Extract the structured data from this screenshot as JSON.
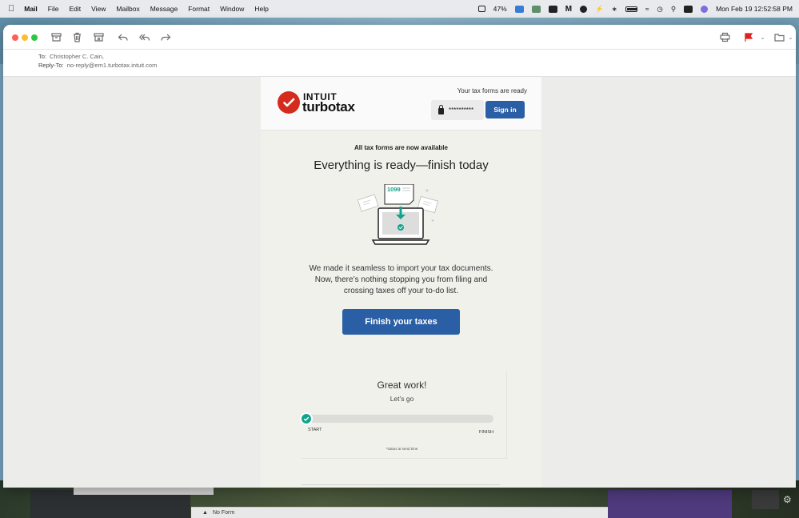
{
  "menubar": {
    "app_name": "Mail",
    "items": [
      "File",
      "Edit",
      "View",
      "Mailbox",
      "Message",
      "Format",
      "Window",
      "Help"
    ],
    "battery_percent": "47%",
    "datetime": "Mon Feb 19  12:52:58 PM"
  },
  "mail": {
    "to_label": "To:",
    "to_value": "Christopher C. Cain,",
    "reply_to_label": "Reply-To:",
    "reply_to_value": "no-reply@em1.turbotax.intuit.com"
  },
  "email": {
    "brand_top": "INTUIT",
    "brand_bottom": "turbotax",
    "forms_ready": "Your tax forms are ready",
    "password_mask": "**********",
    "sign_in_label": "Sign in",
    "small_title": "All tax forms are now available",
    "big_title": "Everything is ready—finish today",
    "illustration_label": "1099",
    "body_line1": "We made it seamless to import your tax documents.",
    "body_line2": "Now, there’s nothing stopping you from filing and",
    "body_line3": "crossing taxes off your to-do list.",
    "cta_label": "Finish your taxes",
    "progress": {
      "title": "Great work!",
      "subtitle": "Let’s go",
      "start_label": "START",
      "finish_label": "FINISH",
      "note": "*status at send time",
      "fraction": 0.0
    }
  },
  "background": {
    "strip_text": "No Form"
  },
  "colors": {
    "brand_blue": "#2a5fa5",
    "intuit_red": "#d52b1e",
    "check_green": "#12a58e",
    "flag_red": "#e0201b"
  }
}
